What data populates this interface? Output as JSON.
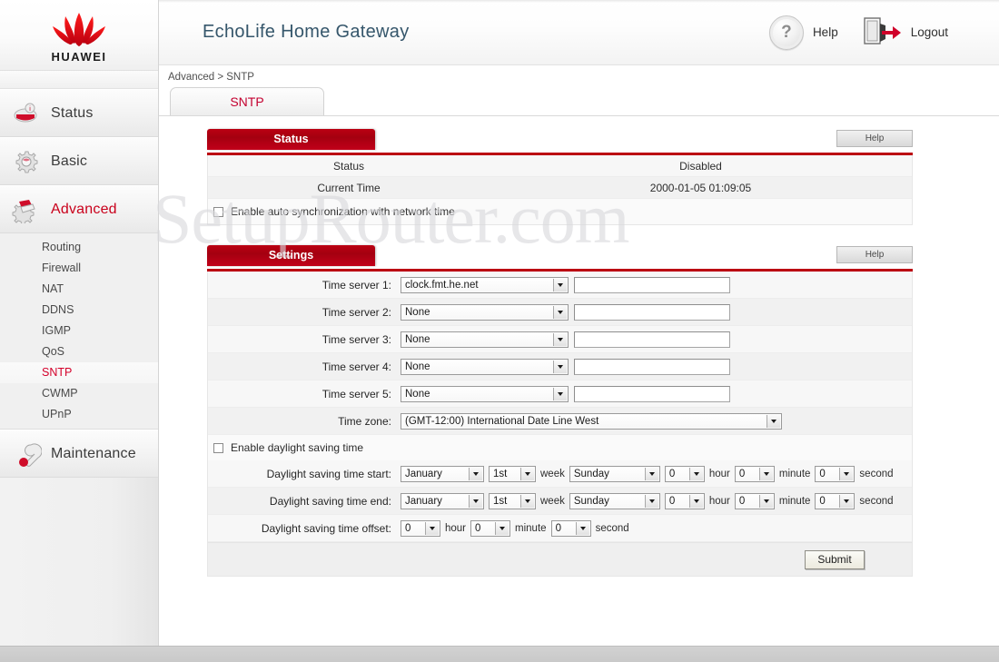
{
  "window": {
    "app_title": "EchoLife Home Gateway",
    "watermark": "SetupRouter.com"
  },
  "topbar": {
    "help_label": "Help",
    "help_icon": "question-circle-icon",
    "logout_label": "Logout",
    "logout_icon": "door-exit-arrow-icon"
  },
  "brand": {
    "wordmark": "HUAWEI"
  },
  "breadcrumb": "Advanced > SNTP",
  "tabs": [
    {
      "label": "SNTP",
      "active": true
    }
  ],
  "sidebar": {
    "items": [
      {
        "label": "Status",
        "icon": "status-icon",
        "active": false
      },
      {
        "label": "Basic",
        "icon": "gear-icon",
        "active": false
      },
      {
        "label": "Advanced",
        "icon": "advanced-gear-icon",
        "active": true
      },
      {
        "label": "Maintenance",
        "icon": "wrench-icon",
        "active": false
      }
    ],
    "advanced_sub": [
      {
        "label": "Routing",
        "active": false
      },
      {
        "label": "Firewall",
        "active": false
      },
      {
        "label": "NAT",
        "active": false
      },
      {
        "label": "DDNS",
        "active": false
      },
      {
        "label": "IGMP",
        "active": false
      },
      {
        "label": "QoS",
        "active": false
      },
      {
        "label": "SNTP",
        "active": true
      },
      {
        "label": "CWMP",
        "active": false
      },
      {
        "label": "UPnP",
        "active": false
      }
    ]
  },
  "status_panel": {
    "title": "Status",
    "help_label": "Help",
    "rows": [
      {
        "key": "Status",
        "value": "Disabled"
      },
      {
        "key": "Current Time",
        "value": "2000-01-05 01:09:05"
      }
    ],
    "auto_sync_label": "Enable auto synchronization with network time",
    "auto_sync_checked": false
  },
  "settings_panel": {
    "title": "Settings",
    "help_label": "Help",
    "time_servers": [
      {
        "label": "Time server 1:",
        "value": "clock.fmt.he.net",
        "text": ""
      },
      {
        "label": "Time server 2:",
        "value": "None",
        "text": ""
      },
      {
        "label": "Time server 3:",
        "value": "None",
        "text": ""
      },
      {
        "label": "Time server 4:",
        "value": "None",
        "text": ""
      },
      {
        "label": "Time server 5:",
        "value": "None",
        "text": ""
      }
    ],
    "timezone_label": "Time zone:",
    "timezone_value": "(GMT-12:00) International Date Line West",
    "dst_enable_label": "Enable daylight saving time",
    "dst_enable_checked": false,
    "dst_start": {
      "label": "Daylight saving time start:",
      "month": "January",
      "ordinal": "1st",
      "week_label": "week",
      "day": "Sunday",
      "hour": "0",
      "hour_label": "hour",
      "minute": "0",
      "minute_label": "minute",
      "second": "0",
      "second_label": "second"
    },
    "dst_end": {
      "label": "Daylight saving time end:",
      "month": "January",
      "ordinal": "1st",
      "week_label": "week",
      "day": "Sunday",
      "hour": "0",
      "hour_label": "hour",
      "minute": "0",
      "minute_label": "minute",
      "second": "0",
      "second_label": "second"
    },
    "dst_offset": {
      "label": "Daylight saving time offset:",
      "hour": "0",
      "hour_label": "hour",
      "minute": "0",
      "minute_label": "minute",
      "second": "0",
      "second_label": "second"
    },
    "submit_label": "Submit"
  },
  "colors": {
    "brand_red": "#bb0012",
    "accent_red": "#d4002a",
    "title_blue": "#35566b",
    "panel_bg": "#fafafa"
  }
}
